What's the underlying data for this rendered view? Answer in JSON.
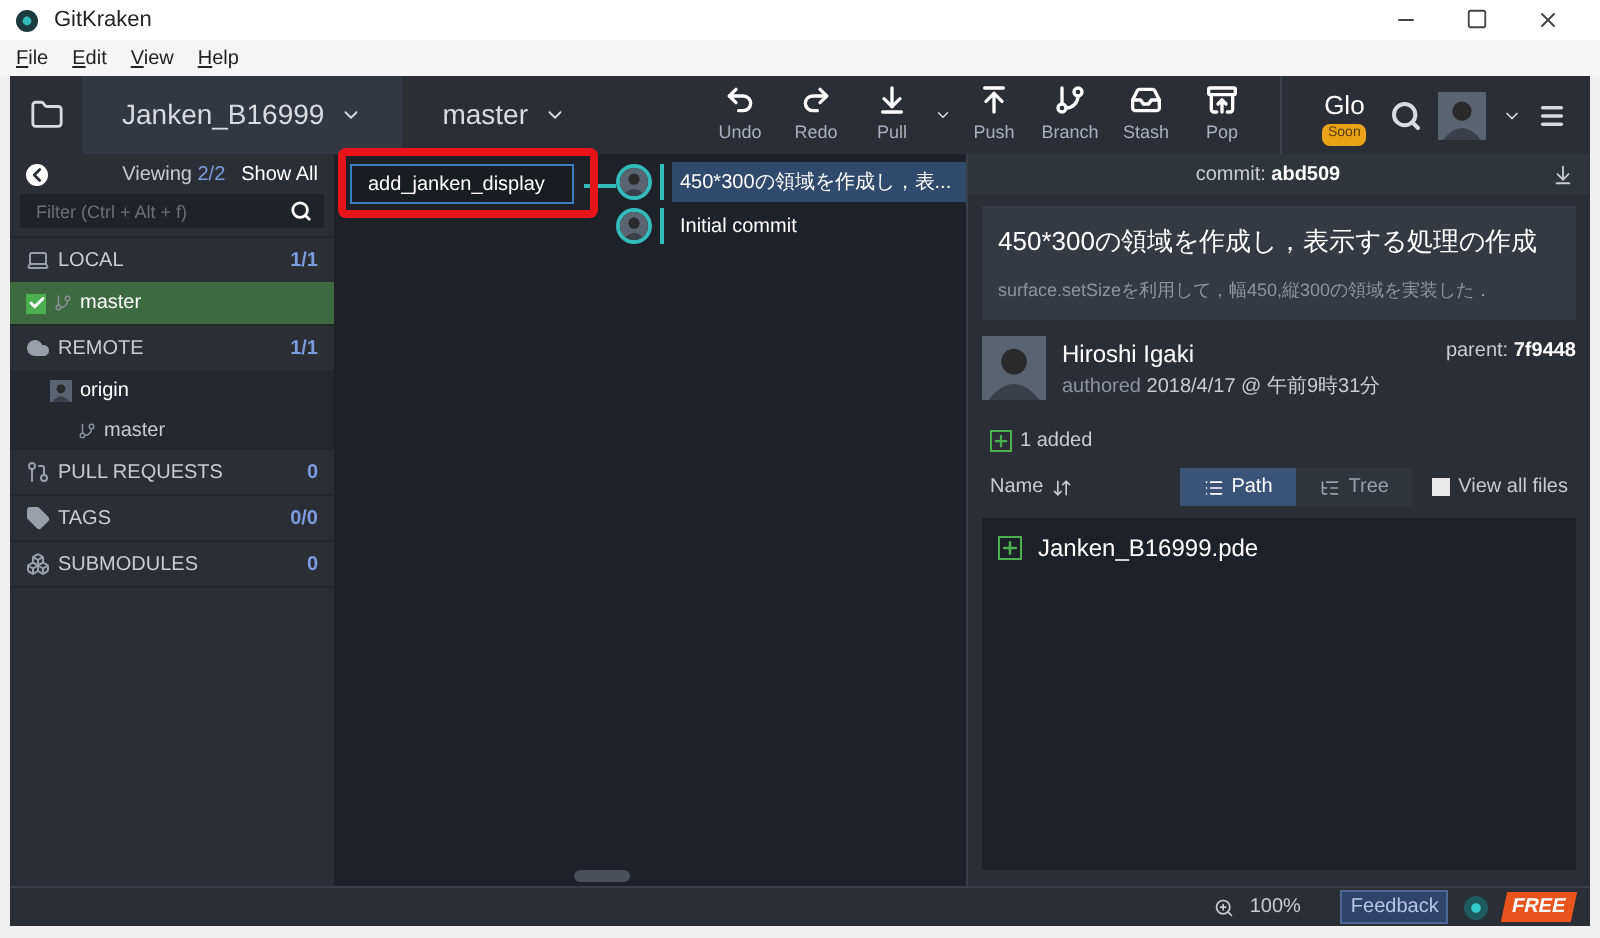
{
  "window": {
    "title": "GitKraken"
  },
  "menu": [
    "File",
    "Edit",
    "View",
    "Help"
  ],
  "toolbar": {
    "repo": "Janken_B16999",
    "branch": "master",
    "actions": [
      {
        "kind": "undo",
        "label": "Undo"
      },
      {
        "kind": "redo",
        "label": "Redo"
      },
      {
        "kind": "pull",
        "label": "Pull"
      },
      {
        "kind": "push",
        "label": "Push"
      },
      {
        "kind": "branch",
        "label": "Branch"
      },
      {
        "kind": "stash",
        "label": "Stash"
      },
      {
        "kind": "pop",
        "label": "Pop"
      }
    ],
    "glo": {
      "label": "Glo",
      "badge": "Soon"
    }
  },
  "sidebar": {
    "viewing_label": "Viewing",
    "viewing_count": "2/2",
    "show_all": "Show All",
    "filter_placeholder": "Filter (Ctrl + Alt + f)",
    "sections": [
      {
        "kind": "local",
        "label": "LOCAL",
        "count": "1/1",
        "items": [
          {
            "label": "master",
            "checked": true,
            "selected": true
          }
        ]
      },
      {
        "kind": "remote",
        "label": "REMOTE",
        "count": "1/1",
        "items": [
          {
            "label": "origin",
            "selected": false,
            "children": [
              {
                "label": "master"
              }
            ]
          }
        ]
      },
      {
        "kind": "pr",
        "label": "PULL REQUESTS",
        "count": "0"
      },
      {
        "kind": "tags",
        "label": "TAGS",
        "count": "0/0"
      },
      {
        "kind": "submodules",
        "label": "SUBMODULES",
        "count": "0"
      }
    ]
  },
  "graph": {
    "branch_input": "add_janken_display",
    "commits": [
      {
        "message": "450*300の領域を作成し，表...",
        "selected": true
      },
      {
        "message": "Initial commit",
        "selected": false
      }
    ]
  },
  "detail": {
    "commit_label": "commit:",
    "commit_id": "abd509",
    "summary": "450*300の領域を作成し，表示する処理の作成",
    "description": "surface.setSizeを利用して，幅450,縦300の領域を実装した．",
    "author": "Hiroshi Igaki",
    "authored_label": "authored",
    "date": "2018/4/17 @ 午前9時31分",
    "parent_label": "parent:",
    "parent_id": "7f9448",
    "added": "1 added",
    "sort_label": "Name",
    "views": [
      {
        "label": "Path",
        "selected": true
      },
      {
        "label": "Tree",
        "selected": false
      }
    ],
    "view_all": {
      "label": "View all files",
      "checked": false
    },
    "files": [
      "Janken_B16999.pde"
    ]
  },
  "status_bar": {
    "zoom": "100%",
    "feedback": "Feedback",
    "plan": "FREE"
  }
}
